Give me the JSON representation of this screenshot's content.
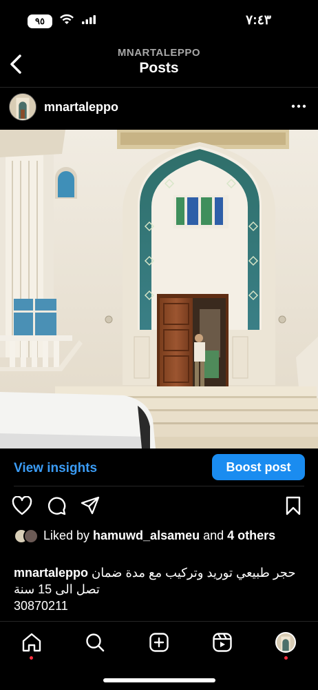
{
  "status_bar": {
    "time": "٧:٤٣",
    "battery": "٩٥",
    "icons": [
      "battery-icon",
      "wifi-icon",
      "signal-icon"
    ]
  },
  "nav": {
    "subtitle": "MNARTALEPPO",
    "title": "Posts",
    "back_icon": "chevron-left-icon"
  },
  "post": {
    "username": "mnartaleppo",
    "more_icon": "more-horizontal-icon",
    "image": "building-entrance-photo"
  },
  "insights": {
    "view_label": "View insights",
    "boost_label": "Boost post"
  },
  "actions": [
    "heart-icon",
    "comment-icon",
    "share-icon",
    "bookmark-icon"
  ],
  "likes": {
    "prefix": "Liked by ",
    "user": "hamuwd_alsameu",
    "middle": " and ",
    "others": "4 others"
  },
  "caption": {
    "user": "mnartaleppo",
    "text": "حجر طبيعي توريد وتركيب مع مدة ضمان تصل الى 15 سنة",
    "number": "30870211"
  },
  "tabs": [
    "home-icon",
    "search-icon",
    "create-icon",
    "reels-icon",
    "profile-avatar"
  ],
  "colors": {
    "accent": "#3b9cf5",
    "boost": "#1a8cf0",
    "notification_dot": "#ff3040",
    "background": "#000000"
  }
}
